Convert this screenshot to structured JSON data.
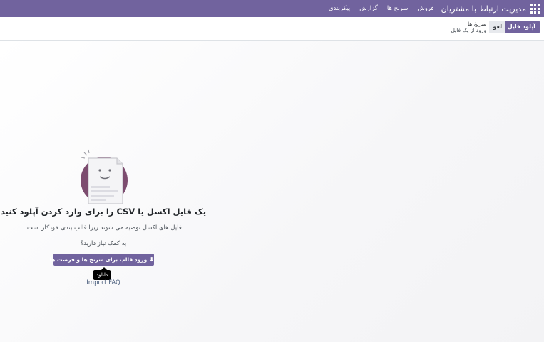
{
  "navbar": {
    "brand": "مدیریت ارتباط با مشتریان",
    "menu": [
      "فروش",
      "سرنخ ها",
      "گزارش",
      "پیکربندی"
    ]
  },
  "control": {
    "upload_label": "آپلود فایل",
    "cancel_label": "لغو",
    "breadcrumb_root": "سرنخ ها",
    "breadcrumb_current": "ورود از یک فایل"
  },
  "help": {
    "title": "یک فایل اکسل یا CSV را برای وارد کردن آپلود کنید",
    "description": "فایل های اکسل توصیه می شوند زیرا قالب بندی خودکار است.",
    "need_help": "به کمک نیاز دارید؟",
    "template_button": "ورود قالب برای سرنخ ها و فرصت ها",
    "template_icon": "download-icon",
    "tooltip": "دانلود",
    "faq_link": "Import FAQ"
  },
  "colors": {
    "brand": "#71639e",
    "illustration_circle": "#7c4c6f"
  }
}
